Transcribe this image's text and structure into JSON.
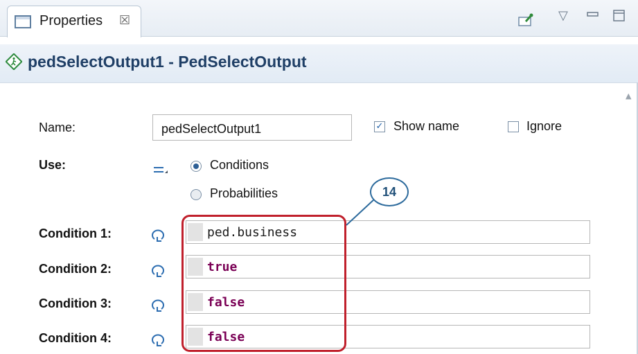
{
  "tab": {
    "label": "Properties",
    "close_glyph": "☒"
  },
  "toolbar": {
    "pin_icon": "pin-icon",
    "menu_glyph": "▽",
    "minimize_glyph": "▭",
    "maximize_glyph": "▭"
  },
  "header": {
    "title": "pedSelectOutput1 - PedSelectOutput"
  },
  "form": {
    "name_label": "Name:",
    "name_value": "pedSelectOutput1",
    "show_name_label": "Show name",
    "show_name_checked": true,
    "ignore_label": "Ignore",
    "ignore_checked": false,
    "use_label": "Use:",
    "use_options": [
      "Conditions",
      "Probabilities"
    ],
    "use_selected": "Conditions",
    "conditions": [
      {
        "label": "Condition 1:",
        "value": "ped.business",
        "style": "plain"
      },
      {
        "label": "Condition 2:",
        "value": "true",
        "style": "keyword"
      },
      {
        "label": "Condition 3:",
        "value": "false",
        "style": "keyword"
      },
      {
        "label": "Condition 4:",
        "value": "false",
        "style": "keyword"
      }
    ]
  },
  "annotation": {
    "callout_number": "14"
  },
  "colors": {
    "highlight": "#c0202c",
    "callout_border": "#2c6a9c",
    "keyword": "#7a0055",
    "title": "#1f3f66"
  }
}
